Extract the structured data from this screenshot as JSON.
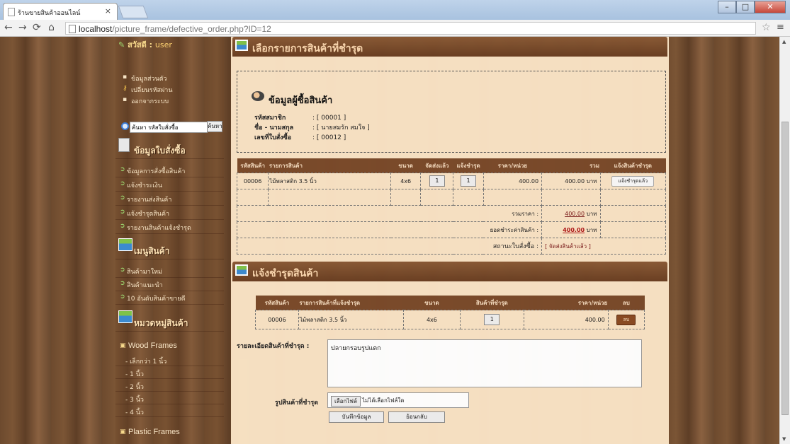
{
  "browser": {
    "tab_title": "ร้านขายสินค้าออนไลน์",
    "tab_close": "×",
    "url_host": "localhost",
    "url_path": "/picture_frame/defective_order.php?ID=12"
  },
  "sidebar": {
    "greeting_prefix": "สวัสดี : ",
    "greeting_user": "user",
    "account_items": [
      "ข้อมูลส่วนตัว",
      "เปลี่ยนรหัสผ่าน",
      "ออกจากระบบ"
    ],
    "search_value": "ค้นหา รหัสใบสั่งซื้อ",
    "search_button": "ค้นหา",
    "order_section": "ข้อมูลใบสั่งซื้อ",
    "order_items": [
      "ข้อมูลการสั่งซื้อสินค้า",
      "แจ้งชำระเงิน",
      "รายงานส่งสินค้า",
      "แจ้งชำรุดสินค้า",
      "รายงานสินค้าแจ้งชำรุด"
    ],
    "product_section": "เมนูสินค้า",
    "product_items": [
      "สินค้ามาใหม่",
      "สินค้าแนะนำ",
      "10 อันดับสินค้าขายดี"
    ],
    "category_section": "หมวดหมู่สินค้า",
    "wood_frames": "Wood Frames",
    "wood_items": [
      "- เล็กกว่า 1 นิ้ว",
      "- 1 นิ้ว",
      "- 2 นิ้ว",
      "- 3 นิ้ว",
      "- 4 นิ้ว"
    ],
    "plastic_frames": "Plastic Frames"
  },
  "main": {
    "panel1_title": "เลือกรายการสินค้าที่ชำรุด",
    "buyer_title": "ข้อมูลผู้ซื้อสินค้า",
    "member_label": "รหัสสมาชิก",
    "member_value": ": [ 00001 ]",
    "name_label": "ชื่อ - นามสกุล",
    "name_value": ": [ นายสมรัก สมใจ ]",
    "order_label": "เลขที่ใบสั่งซื้อ",
    "order_value": ": [ 00012 ]",
    "table1": {
      "headers": [
        "รหัสสินค้า",
        "รายการสินค้า",
        "ขนาด",
        "จัดส่งแล้ว",
        "แจ้งชำรุด",
        "ราคา/หน่วย",
        "รวม",
        "แจ้งสินค้าชำรุด"
      ],
      "row": {
        "code": "00006",
        "name": "ไม้พลาสติก 3.5 นิ้ว",
        "size": "4x6",
        "shipped": "1",
        "defective": "1",
        "unit_price": "400.00",
        "total": "400.00 บาท",
        "action": "แจ้งชำรุดแล้ว"
      },
      "sum_label": "รวมราคา :",
      "sum_value": "400.00",
      "sum_unit": "บาท",
      "paid_label": "ยอดชำระค่าสินค้า :",
      "paid_value": "400.00",
      "paid_unit": "บาท",
      "status_label": "สถานะใบสั่งซื้อ :",
      "status_value": "[ จัดส่งสินค้าแล้ว ]"
    },
    "panel2_title": "แจ้งชำรุดสินค้า",
    "table2": {
      "headers": [
        "รหัสสินค้า",
        "รายการสินค้าที่แจ้งชำรุด",
        "ขนาด",
        "สินค้าที่ชำรุด",
        "ราคา/หน่วย",
        "ลบ"
      ],
      "row": {
        "code": "00006",
        "name": "ไม้พลาสติก 3.5 นิ้ว",
        "size": "4x6",
        "qty": "1",
        "unit_price": "400.00",
        "delete": "ลบ"
      }
    },
    "detail_label": "รายละเอียดสินค้าที่ชำรุด :",
    "detail_value": "ปลายกรอบรูปแตก",
    "image_label": "รูปสินค้าที่ชำรุด",
    "file_button": "เลือกไฟล์",
    "file_none": "ไม่ได้เลือกไฟล์ใด",
    "save_button": "บันทึกข้อมูล",
    "back_button": "ย้อนกลับ"
  }
}
